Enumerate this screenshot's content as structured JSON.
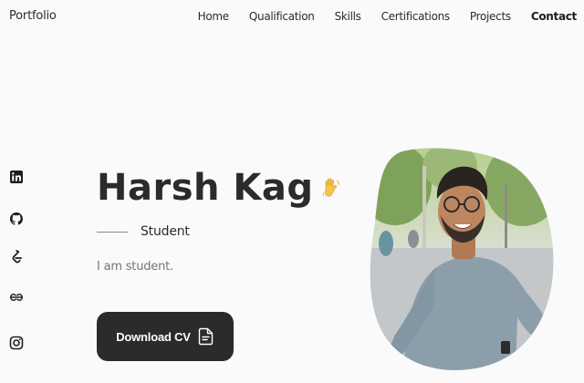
{
  "header": {
    "logo": "Portfolio",
    "nav": [
      "Home",
      "Qualification",
      "Skills",
      "Certifications",
      "Projects",
      "Contact"
    ]
  },
  "social": {
    "icons": [
      "linkedin-icon",
      "github-icon",
      "leetcode-icon",
      "geeksforgeeks-icon",
      "instagram-icon"
    ]
  },
  "hero": {
    "name": "Harsh Kag",
    "role": "Student",
    "description": "I am student.",
    "cv_button": "Download CV"
  },
  "colors": {
    "background": "#fafafa",
    "text": "#2b2b2b",
    "muted": "#757575",
    "button": "#2b2b2b"
  }
}
